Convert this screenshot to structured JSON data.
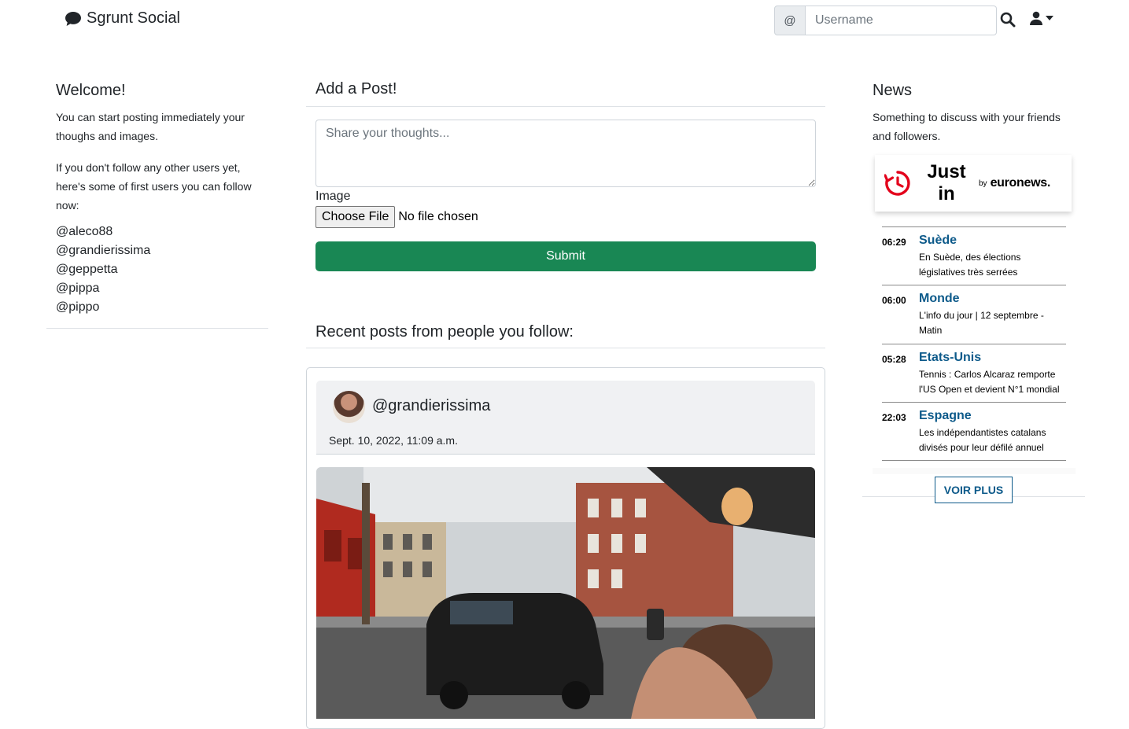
{
  "navbar": {
    "brand": "Sgrunt Social",
    "search_prefix": "@",
    "search_placeholder": "Username"
  },
  "left": {
    "title": "Welcome!",
    "intro": "You can start posting immediately your thoughs and images.",
    "suggest": "If you don't follow any other users yet, here's some of first users you can follow now:",
    "users": [
      "@aleco88",
      "@grandierissima",
      "@geppetta",
      "@pippa",
      "@pippo"
    ]
  },
  "composer": {
    "title": "Add a Post!",
    "placeholder": "Share your thoughts...",
    "image_label": "Image",
    "choose_file": "Choose File",
    "file_status": "No file chosen",
    "submit": "Submit"
  },
  "feed": {
    "title": "Recent posts from people you follow:",
    "posts": [
      {
        "user": "@grandierissima",
        "date": "Sept. 10, 2022, 11:09 a.m."
      }
    ]
  },
  "news": {
    "title": "News",
    "subtitle": "Something to discuss with your friends and followers.",
    "widget": {
      "title": "Just in",
      "by": "by",
      "logo": "euronews.",
      "items": [
        {
          "time": "06:29",
          "category": "Suède",
          "text": "En Suède, des élections législatives très serrées"
        },
        {
          "time": "06:00",
          "category": "Monde",
          "text": "L'info du jour | 12 septembre - Matin"
        },
        {
          "time": "05:28",
          "category": "Etats-Unis",
          "text": "Tennis : Carlos Alcaraz remporte l'US Open et devient N°1 mondial"
        },
        {
          "time": "22:03",
          "category": "Espagne",
          "text": "Les indépendantistes catalans divisés pour leur défilé annuel"
        }
      ],
      "more": "VOIR PLUS"
    }
  },
  "colors": {
    "submit_green": "#198754",
    "news_blue": "#0d5a8a",
    "euronews_red": "#e3001b"
  }
}
